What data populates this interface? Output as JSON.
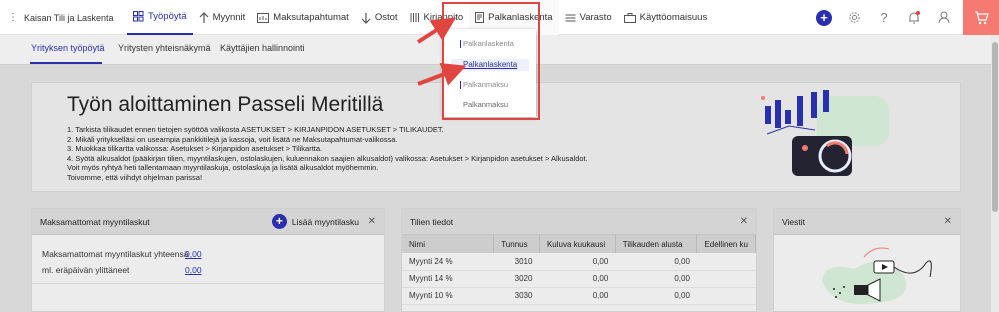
{
  "company": "Kaisan Tili ja Laskenta",
  "nav": [
    {
      "label": "Työpöytä",
      "icon": "dashboard-icon"
    },
    {
      "label": "Myynnit",
      "icon": "arrow-up-icon"
    },
    {
      "label": "Maksutapahtumat",
      "icon": "bank-icon"
    },
    {
      "label": "Ostot",
      "icon": "arrow-down-icon"
    },
    {
      "label": "Kirjanpito",
      "icon": "book-icon"
    },
    {
      "label": "Palkanlaskenta",
      "icon": "document-icon"
    },
    {
      "label": "Varasto",
      "icon": "warehouse-icon"
    },
    {
      "label": "Käyttöomaisuus",
      "icon": "briefcase-icon"
    }
  ],
  "subtabs": [
    "Yrityksen työpöytä",
    "Yritysten yhteisnäkymä",
    "Käyttäjien hallinnointi"
  ],
  "dropdown": [
    "Palkanlaskenta",
    "Palkanlaskenta",
    "Palkanmaksu",
    "Palkanmaksu"
  ],
  "banner": {
    "title": "Työn aloittaminen Passeli Meritillä",
    "lines": [
      "1. Tarkista tilikaudet ennen tietojen syöttöä valikosta ASETUKSET > KIRJANPIDON ASETUKSET > TILIKAUDET.",
      "2. Mikäli yritykselläsi on useampia pankkitilejä ja kassoja, voit lisätä ne Maksutapahtumat-valikossa.",
      "3. Muokkaa tilikartta valikossa: Asetukset > Kirjanpidon asetukset > Tilikartta.",
      "4. Syötä alkusaldot (pääkirjan tilien, myyntilaskujen, ostolaskujen, kuluennakon saajien alkusaldot) valikossa: Asetukset > Kirjanpidon asetukset > Alkusaldot.",
      "Voit myös ryhtyä heti tallentamaan myyntilaskuja, ostolaskuja ja lisätä alkusaldot myöhemmin.",
      "Toivomme, että viihdyt ohjelman parissa!"
    ]
  },
  "unpaid": {
    "title": "Maksamattomat myyntilaskut",
    "add_label": "Lisää myyntilasku",
    "rows": [
      {
        "label": "Maksamattomat myyntilaskut yhteensä",
        "value": "0,00"
      },
      {
        "label": "ml. eräpäivän ylittäneet",
        "value": "0,00"
      }
    ]
  },
  "accounts": {
    "title": "Tilien tiedot",
    "columns": [
      "Nimi",
      "Tunnus",
      "Kuluva kuukausi",
      "Tilikauden alusta",
      "Edellinen ku"
    ],
    "rows": [
      [
        "Myynti 24 %",
        "3010",
        "0,00",
        "0,00",
        ""
      ],
      [
        "Myynti 14 %",
        "3020",
        "0,00",
        "0,00",
        ""
      ],
      [
        "Myynti 10 %",
        "3030",
        "0,00",
        "0,00",
        ""
      ]
    ]
  },
  "messages": {
    "title": "Viestit"
  },
  "colors": {
    "accent": "#2a2fae",
    "highlight": "#e0453f",
    "cart": "#f47a72"
  }
}
